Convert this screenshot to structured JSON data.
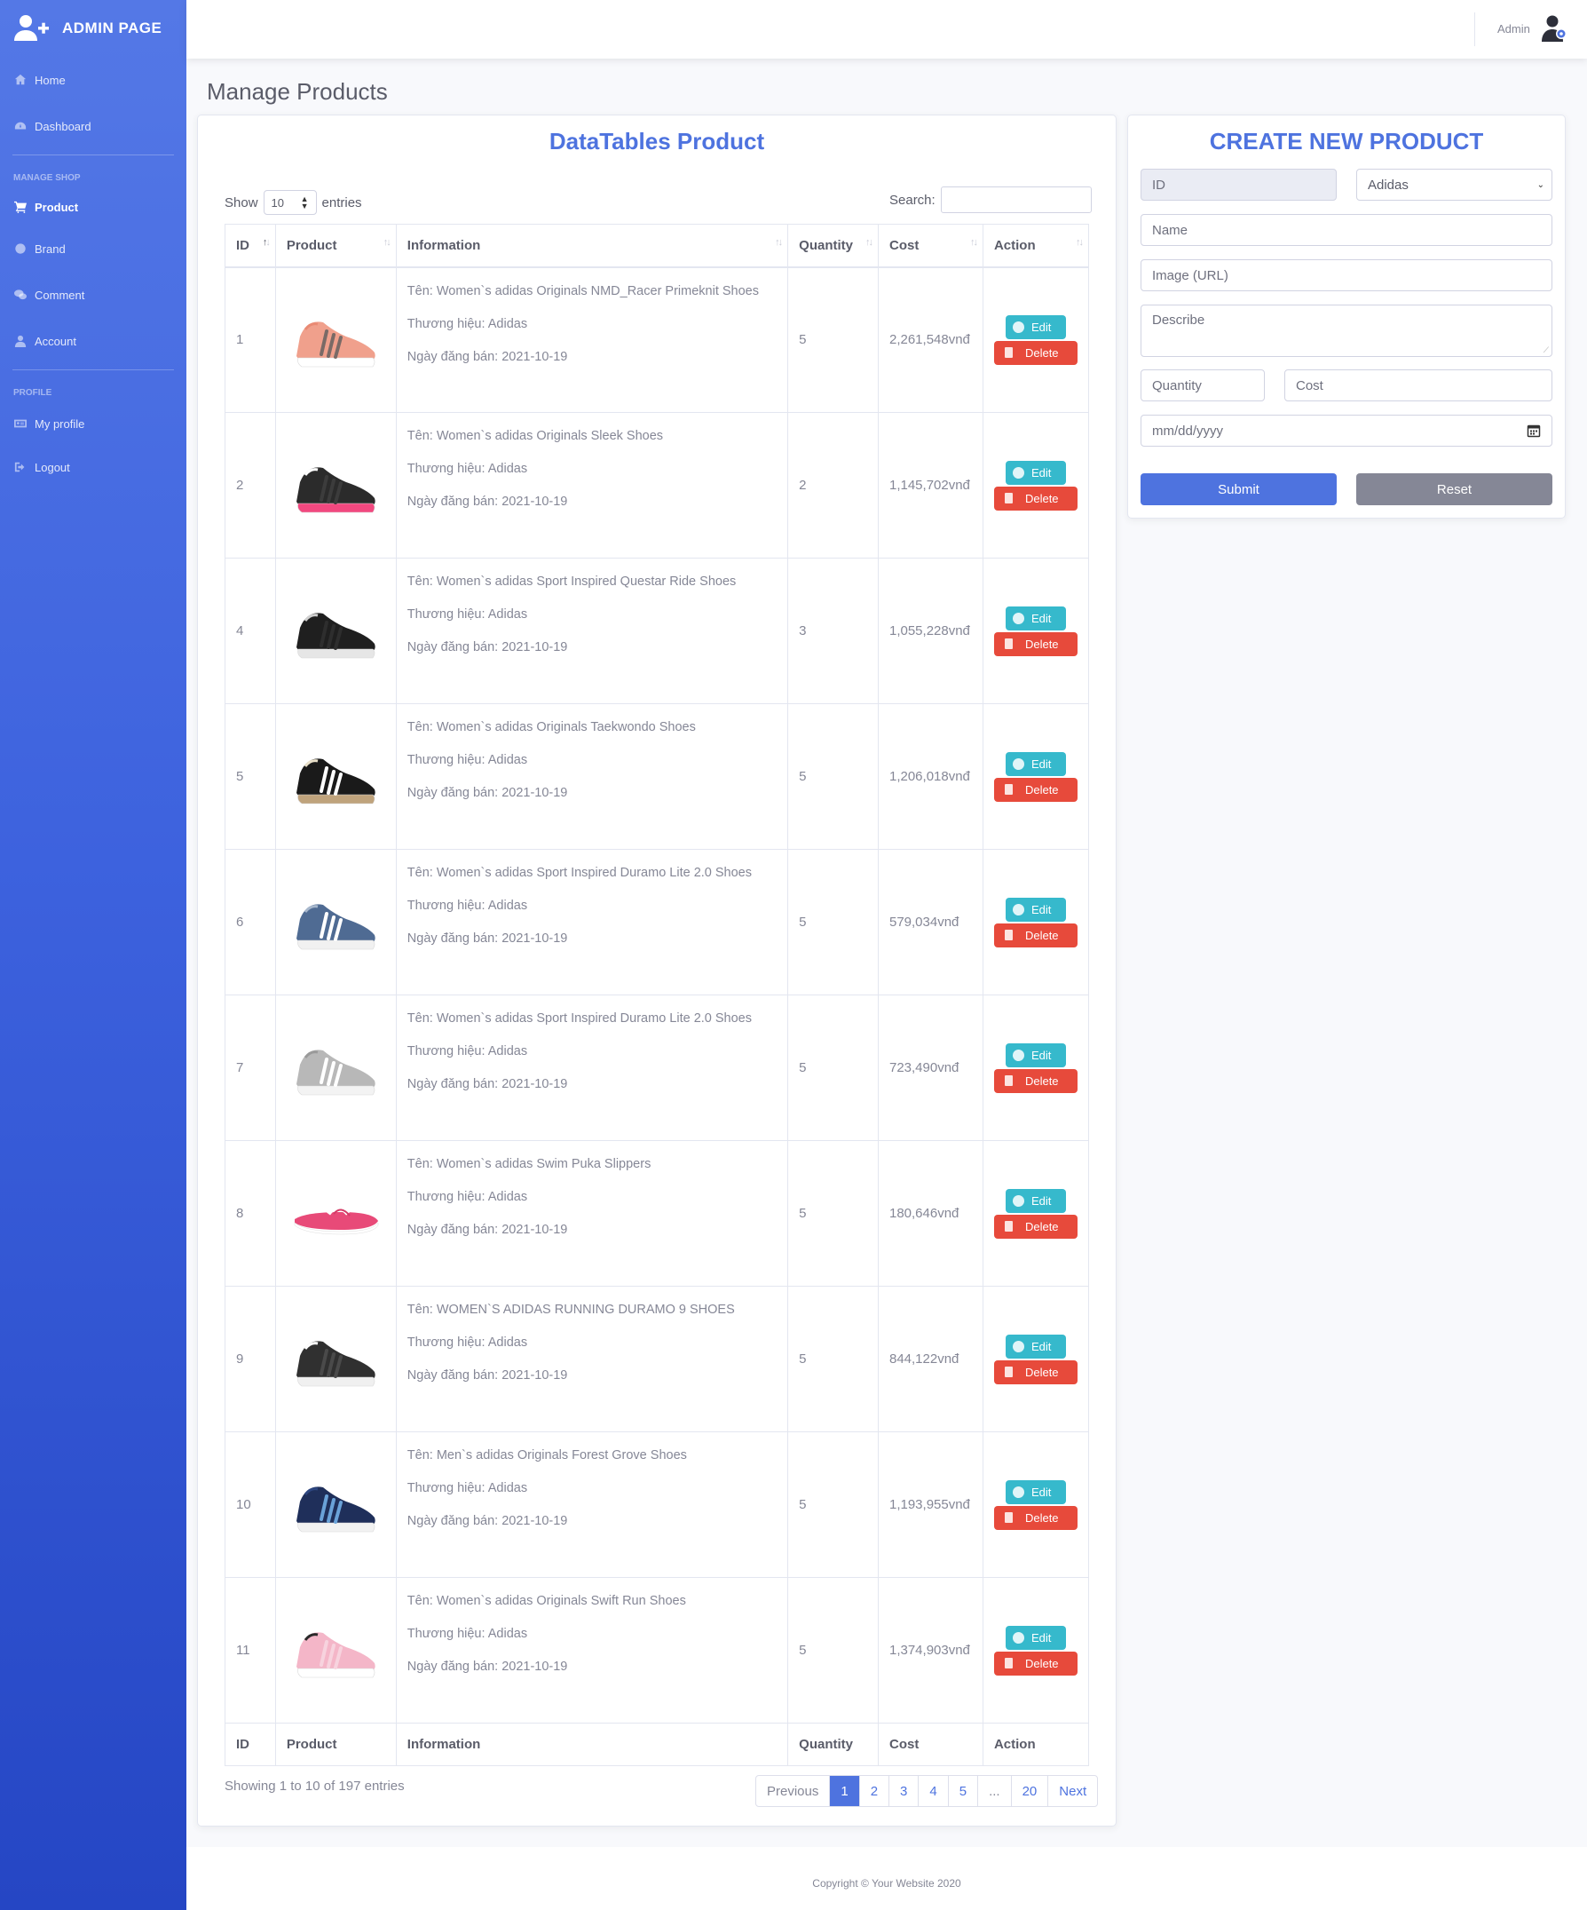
{
  "sidebar": {
    "brand": "ADMIN PAGE",
    "items": [
      {
        "label": "Home"
      },
      {
        "label": "Dashboard"
      },
      {
        "label": "Product"
      },
      {
        "label": "Brand"
      },
      {
        "label": "Comment"
      },
      {
        "label": "Account"
      },
      {
        "label": "My profile"
      },
      {
        "label": "Logout"
      }
    ],
    "headings": {
      "shop": "MANAGE SHOP",
      "profile": "PROFILE"
    }
  },
  "topbar": {
    "user": "Admin"
  },
  "page": {
    "title": "Manage Products"
  },
  "datatable": {
    "title": "DataTables Product",
    "show_label": "Show",
    "page_length": "10",
    "entries_label": "entries",
    "search_label": "Search:",
    "columns": [
      "ID",
      "Product",
      "Information",
      "Quantity",
      "Cost",
      "Action"
    ],
    "name_prefix": "Tên: ",
    "brand_prefix": "Thương hiệu: ",
    "date_prefix": "Ngày đăng bán: ",
    "edit_label": "Edit",
    "delete_label": "Delete",
    "rows": [
      {
        "id": "1",
        "name": "Women`s adidas Originals NMD_Racer Primeknit Shoes",
        "brand": "Adidas",
        "date": "2021-10-19",
        "quantity": "5",
        "cost": "2,261,548vnđ",
        "shoe": "shoe-peach"
      },
      {
        "id": "2",
        "name": "Women`s adidas Originals Sleek Shoes",
        "brand": "Adidas",
        "date": "2021-10-19",
        "quantity": "2",
        "cost": "1,145,702vnđ",
        "shoe": "shoe-black-pink"
      },
      {
        "id": "4",
        "name": "Women`s adidas Sport Inspired Questar Ride Shoes",
        "brand": "Adidas",
        "date": "2021-10-19",
        "quantity": "3",
        "cost": "1,055,228vnđ",
        "shoe": "shoe-black"
      },
      {
        "id": "5",
        "name": "Women`s adidas Originals Taekwondo Shoes",
        "brand": "Adidas",
        "date": "2021-10-19",
        "quantity": "5",
        "cost": "1,206,018vnđ",
        "shoe": "shoe-black-stripes"
      },
      {
        "id": "6",
        "name": "Women`s adidas Sport Inspired Duramo Lite 2.0 Shoes",
        "brand": "Adidas",
        "date": "2021-10-19",
        "quantity": "5",
        "cost": "579,034vnđ",
        "shoe": "shoe-blue-grey"
      },
      {
        "id": "7",
        "name": "Women`s adidas Sport Inspired Duramo Lite 2.0 Shoes",
        "brand": "Adidas",
        "date": "2021-10-19",
        "quantity": "5",
        "cost": "723,490vnđ",
        "shoe": "shoe-light-grey"
      },
      {
        "id": "8",
        "name": "Women`s adidas Swim Puka Slippers",
        "brand": "Adidas",
        "date": "2021-10-19",
        "quantity": "5",
        "cost": "180,646vnđ",
        "shoe": "slipper-pink"
      },
      {
        "id": "9",
        "name": "WOMEN`S ADIDAS RUNNING DURAMO 9 SHOES",
        "brand": "Adidas",
        "date": "2021-10-19",
        "quantity": "5",
        "cost": "844,122vnđ",
        "shoe": "shoe-dark-grey"
      },
      {
        "id": "10",
        "name": "Men`s adidas Originals Forest Grove Shoes",
        "brand": "Adidas",
        "date": "2021-10-19",
        "quantity": "5",
        "cost": "1,193,955vnđ",
        "shoe": "shoe-navy"
      },
      {
        "id": "11",
        "name": "Women`s adidas Originals Swift Run Shoes",
        "brand": "Adidas",
        "date": "2021-10-19",
        "quantity": "5",
        "cost": "1,374,903vnđ",
        "shoe": "shoe-pink"
      }
    ],
    "info": "Showing 1 to 10 of 197 entries",
    "pagination": [
      "Previous",
      "1",
      "2",
      "3",
      "4",
      "5",
      "...",
      "20",
      "Next"
    ],
    "current_page": "1"
  },
  "form": {
    "title": "CREATE NEW PRODUCT",
    "id_placeholder": "ID",
    "brand_value": "Adidas",
    "name_placeholder": "Name",
    "image_placeholder": "Image (URL)",
    "describe_placeholder": "Describe",
    "quantity_placeholder": "Quantity",
    "cost_placeholder": "Cost",
    "date_placeholder": "mm/dd/yyyy",
    "submit_label": "Submit",
    "reset_label": "Reset"
  },
  "footer": {
    "copyright": "Copyright © Your Website 2020"
  },
  "colors": {
    "primary": "#4e73df",
    "info": "#36b9cc",
    "danger": "#e74a3b",
    "secondary": "#858796"
  }
}
